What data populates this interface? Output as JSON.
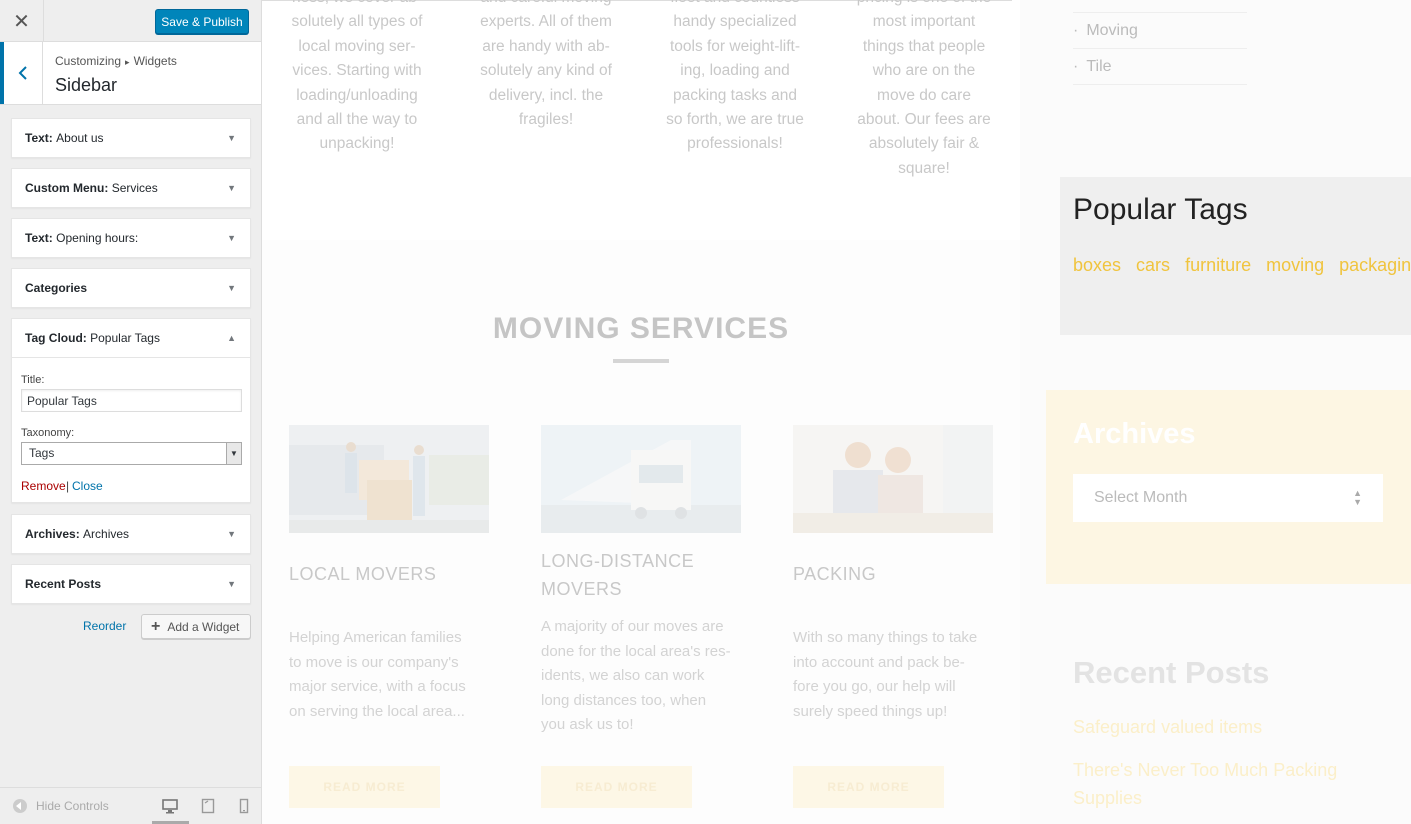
{
  "customizer": {
    "publish_label": "Save & Publish",
    "breadcrumb": {
      "root": "Customizing",
      "section": "Widgets"
    },
    "section_title": "Sidebar",
    "widgets": [
      {
        "type": "Text",
        "title": "About us"
      },
      {
        "type": "Custom Menu",
        "title": "Services"
      },
      {
        "type": "Text",
        "title": "Opening hours:"
      },
      {
        "type": "Categories",
        "title": ""
      },
      {
        "type": "Tag Cloud",
        "title": "Popular Tags"
      },
      {
        "type": "Archives",
        "title": "Archives"
      },
      {
        "type": "Recent Posts",
        "title": ""
      }
    ],
    "tag_cloud_form": {
      "title_label": "Title:",
      "title_value": "Popular Tags",
      "taxonomy_label": "Taxonomy:",
      "taxonomy_value": "Tags",
      "remove_label": "Remove",
      "separator": "|",
      "close_label": "Close"
    },
    "reorder_label": "Reorder",
    "add_widget_label": "Add a Widget",
    "hide_controls_label": "Hide Controls",
    "accent_color": "#0073aa"
  },
  "preview": {
    "intro_columns": [
      [
        "ness, we cover ab-",
        "solutely all types of",
        "local moving ser-",
        "vices. Starting with",
        "loading/unloading",
        "and all the way to",
        "unpacking!"
      ],
      [
        "and careful moving",
        "experts. All of them",
        "are handy with ab-",
        "solutely any kind of",
        "delivery, incl. the",
        "fragiles!"
      ],
      [
        "fleet and countless",
        "handy specialized",
        "tools for weight-lift-",
        "ing, loading and",
        "packing tasks and",
        "so forth, we are true",
        "professionals!"
      ],
      [
        "pricing is one of the",
        "most important",
        "things that people",
        "who are on the",
        "move do care",
        "about. Our fees are",
        "absolutely fair &",
        "square!"
      ]
    ],
    "services_heading": "MOVING SERVICES",
    "services": [
      {
        "title": "LOCAL MOVERS",
        "text": [
          "Helping American families",
          "to move is our company's",
          "major service, with a focus",
          "on serving the local area..."
        ],
        "button": "READ MORE"
      },
      {
        "title": "LONG-DISTANCE MOVERS",
        "text": [
          "A majority of our moves are",
          "done for the local area's res-",
          "idents, we also can work",
          "long distances too, when",
          "you ask us to!"
        ],
        "button": "READ MORE"
      },
      {
        "title": "PACKING",
        "text": [
          "With so many things to take",
          "into account and pack be-",
          "fore you go, our help will",
          "surely speed things up!"
        ],
        "button": "READ MORE"
      }
    ],
    "categories": [
      "Moving",
      "Tile"
    ],
    "popular_tags_title": "Popular Tags",
    "tags": [
      "boxes",
      "cars",
      "furniture",
      "moving",
      "packaging"
    ],
    "archives_title": "Archives",
    "archives_select": "Select Month",
    "recent_posts_title": "Recent Posts",
    "recent_posts": [
      "Safeguard valued items",
      "There's Never Too Much Packing Supplies"
    ],
    "tag_color": "#f0c43e"
  }
}
